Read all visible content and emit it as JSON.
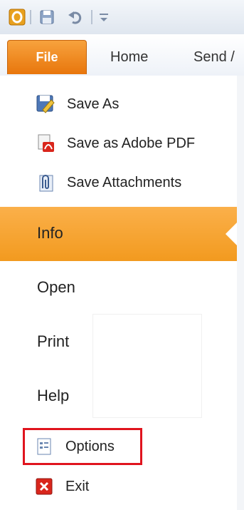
{
  "app": "Outlook",
  "quick_access": {
    "app_icon": "outlook-icon",
    "save_icon": "save-icon",
    "undo_icon": "undo-icon",
    "customize_icon": "customize-icon"
  },
  "ribbon": {
    "tabs": [
      {
        "label": "File",
        "active": true
      },
      {
        "label": "Home"
      },
      {
        "label": "Send /"
      }
    ]
  },
  "backstage": {
    "commands": [
      {
        "label": "Save As",
        "icon": "save-as-icon"
      },
      {
        "label": "Save as Adobe PDF",
        "icon": "pdf-icon"
      },
      {
        "label": "Save Attachments",
        "icon": "attachments-icon"
      }
    ],
    "nav": [
      {
        "label": "Info",
        "selected": true
      },
      {
        "label": "Open"
      },
      {
        "label": "Print"
      },
      {
        "label": "Help"
      }
    ],
    "options": {
      "label": "Options",
      "icon": "options-icon",
      "highlighted": true
    },
    "exit": {
      "label": "Exit",
      "icon": "exit-icon"
    }
  },
  "colors": {
    "accent": "#f29a1f",
    "highlight_border": "#e0141e"
  }
}
